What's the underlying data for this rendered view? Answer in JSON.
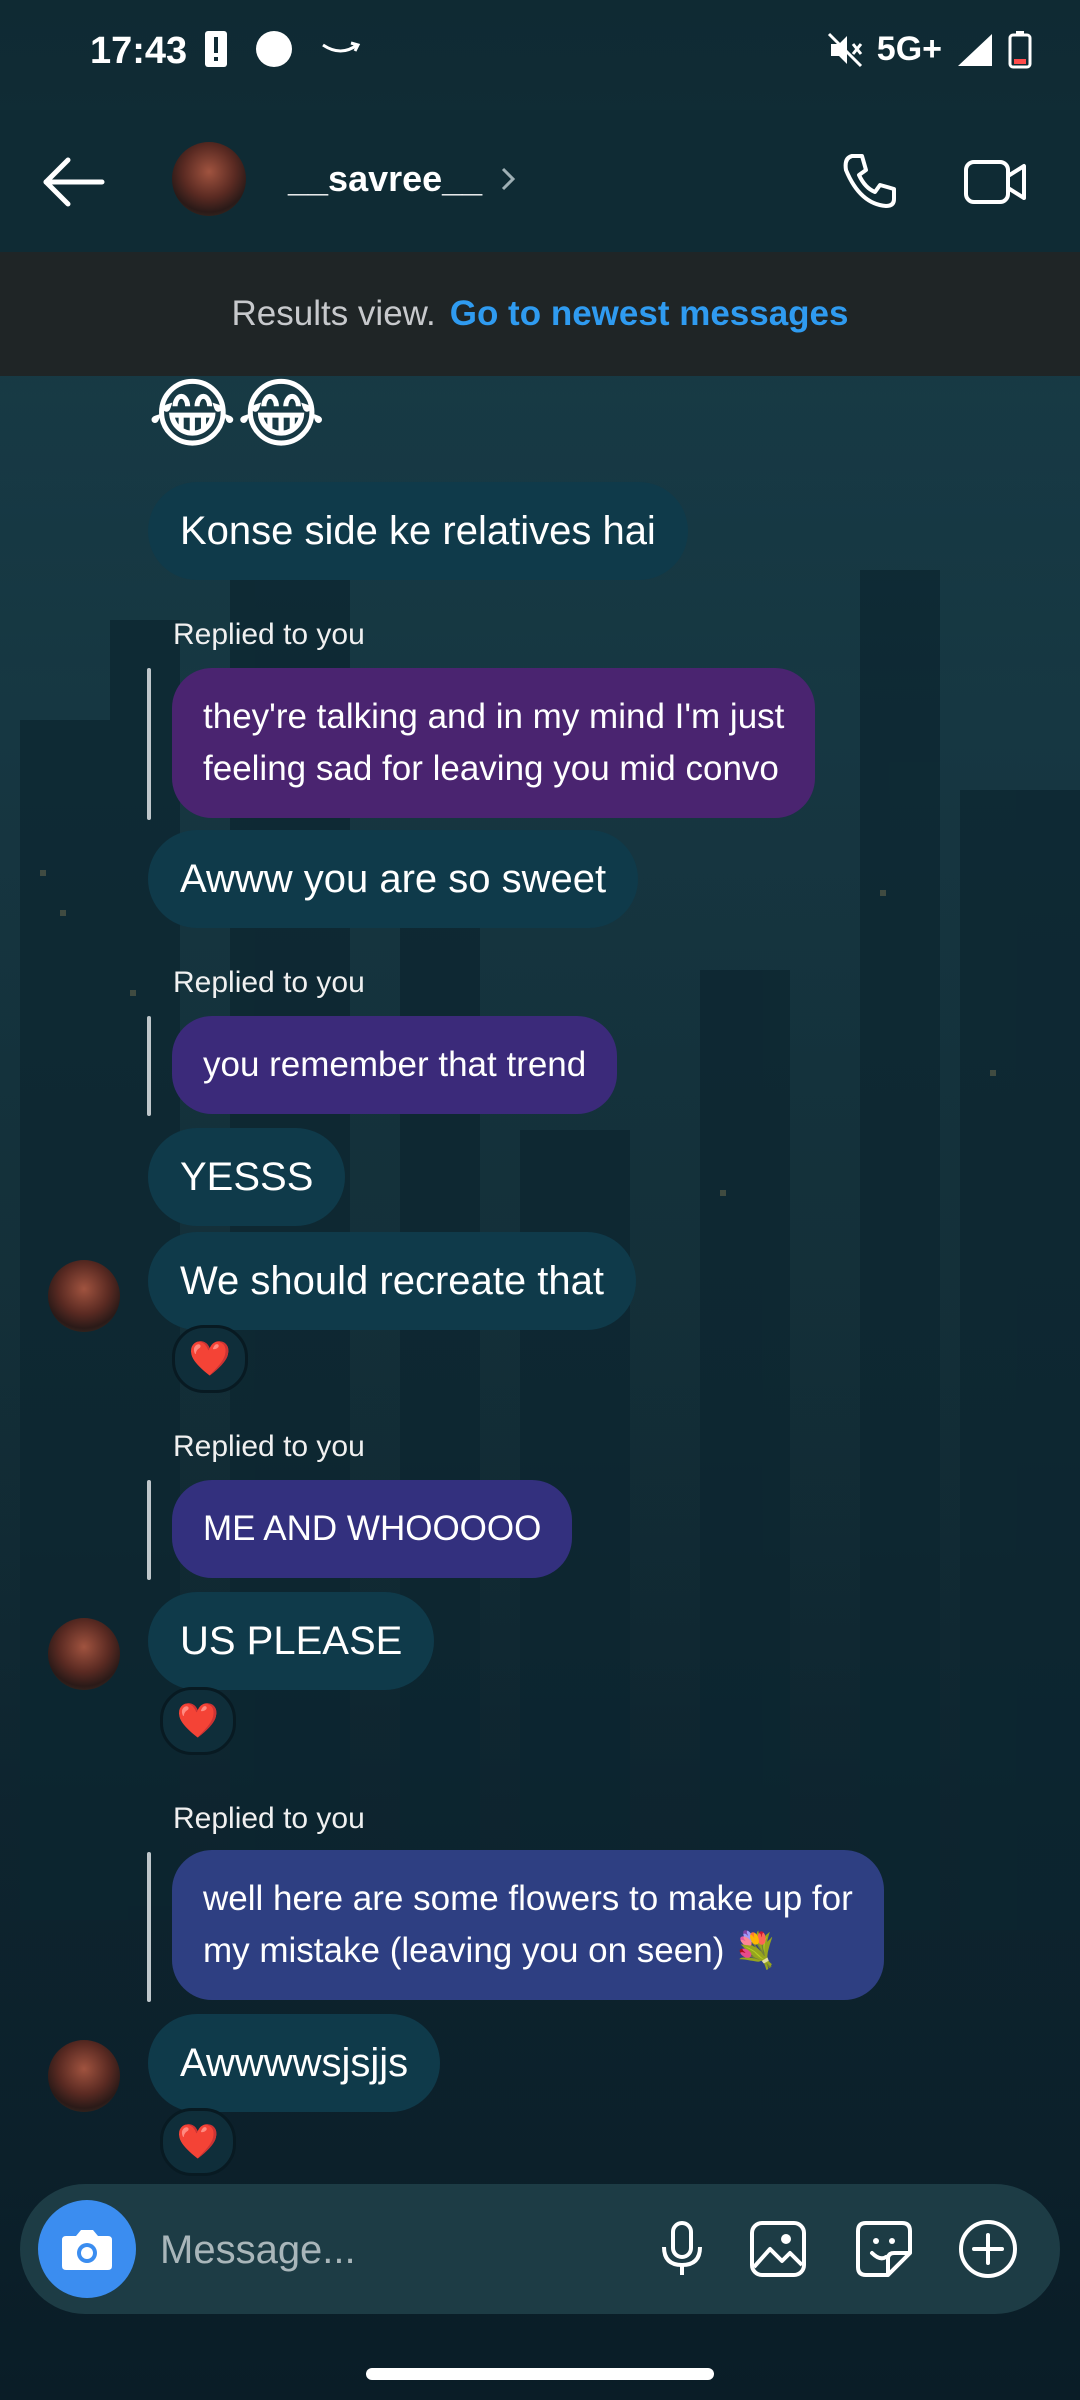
{
  "status": {
    "time": "17:43",
    "network": "5G+"
  },
  "header": {
    "username": "__savree__"
  },
  "results": {
    "label": "Results view.",
    "link": "Go to newest messages"
  },
  "messages": {
    "emoji_line": "😂😂",
    "m1": "Konse side ke relatives hai",
    "reply1_label": "Replied to you",
    "reply1_quote_line1": "they're talking and in my mind I'm just",
    "reply1_quote_line2": "feeling sad for leaving you mid convo",
    "m2": "Awww you are so sweet",
    "reply2_label": "Replied to you",
    "reply2_quote": "you remember that trend",
    "m3": "YESSS",
    "m4": "We should recreate that",
    "m4_reaction": "❤️",
    "reply3_label": "Replied to you",
    "reply3_quote": "ME AND WHOOOOO",
    "m5": "US PLEASE",
    "m5_reaction": "❤️",
    "reply4_label": "Replied to you",
    "reply4_quote_line1": "well here are some flowers to make up for",
    "reply4_quote_line2": "my mistake (leaving you on seen) 💐",
    "m6": "Awwwwsjsjjs",
    "m6_reaction": "❤️"
  },
  "composer": {
    "placeholder": "Message..."
  },
  "colors": {
    "header_bg": "#0f2b34",
    "results_bg": "#1f2526",
    "link": "#2f9bf0",
    "received_bubble": "#0f3a4a",
    "quote_purple": "#4a2470",
    "quote_violet": "#3b2a7a",
    "quote_indigo": "#33307e",
    "quote_blue": "#2e3f82",
    "camera_button": "#3b8df0"
  }
}
